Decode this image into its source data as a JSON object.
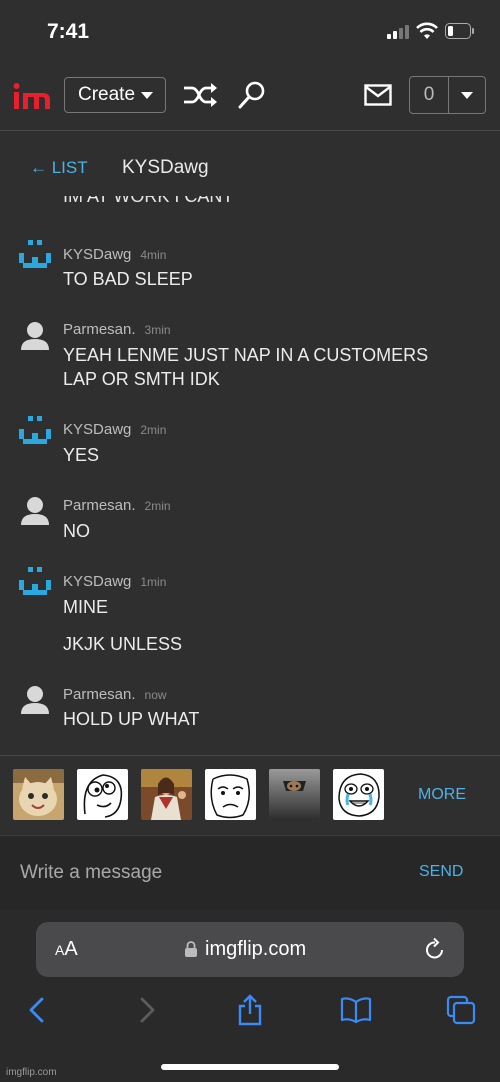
{
  "status_bar": {
    "time": "7:41"
  },
  "navbar": {
    "logo": "imgflip-logo",
    "create_label": "Create",
    "notification_count": "0"
  },
  "chat": {
    "back_label": "← LIST",
    "title": "KYSDawg",
    "partial_message": "IM AT WORK I CANT",
    "messages": [
      {
        "user": "KYSDawg",
        "time": "4min",
        "lines": [
          "TO BAD SLEEP"
        ]
      },
      {
        "user": "Parmesan.",
        "time": "3min",
        "lines": [
          "YEAH LENME JUST NAP IN A CUSTOMERS",
          "LAP OR SMTH IDK"
        ]
      },
      {
        "user": "KYSDawg",
        "time": "2min",
        "lines": [
          "YES"
        ]
      },
      {
        "user": "Parmesan.",
        "time": "2min",
        "lines": [
          "NO"
        ]
      },
      {
        "user": "KYSDawg",
        "time": "1min",
        "lines": [
          "MINE",
          "JKJK UNLESS"
        ]
      },
      {
        "user": "Parmesan.",
        "time": "now",
        "lines": [
          "HOLD UP WHAT"
        ]
      }
    ]
  },
  "meme_strip": {
    "memes": [
      "smiling-cat-meme",
      "derp-face-meme",
      "buddy-christ-meme",
      "okay-face-meme",
      "ceiling-cat-meme",
      "happy-crying-meme"
    ],
    "more_label": "MORE"
  },
  "composer": {
    "placeholder": "Write a message",
    "send_label": "SEND"
  },
  "browser": {
    "aa_label_small": "A",
    "aa_label_large": "A",
    "url": "imgflip.com"
  },
  "watermark": "imgflip.com",
  "colors": {
    "accent": "#4ab3e8",
    "background": "#2f2f2f",
    "logo_red": "#e8202d"
  }
}
